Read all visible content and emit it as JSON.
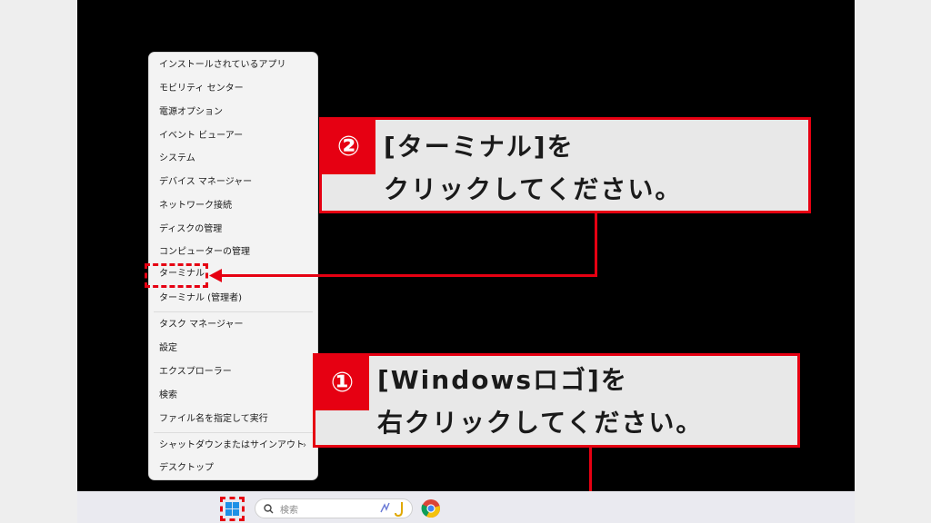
{
  "context_menu": {
    "items": [
      {
        "label": "インストールされているアプリ"
      },
      {
        "label": "モビリティ センター"
      },
      {
        "label": "電源オプション"
      },
      {
        "label": "イベント ビューアー"
      },
      {
        "label": "システム"
      },
      {
        "label": "デバイス マネージャー"
      },
      {
        "label": "ネットワーク接続"
      },
      {
        "label": "ディスクの管理"
      },
      {
        "label": "コンピューターの管理"
      },
      {
        "label": "ターミナル"
      },
      {
        "label": "ターミナル (管理者)"
      },
      {
        "label": "タスク マネージャー"
      },
      {
        "label": "設定"
      },
      {
        "label": "エクスプローラー"
      },
      {
        "label": "検索"
      },
      {
        "label": "ファイル名を指定して実行"
      },
      {
        "label": "シャットダウンまたはサインアウト"
      },
      {
        "label": "デスクトップ"
      }
    ],
    "submenu_arrow": "›"
  },
  "callouts": {
    "step2": {
      "number": "②",
      "line1": "[ターミナル]を",
      "line2": "クリックしてください。"
    },
    "step1": {
      "number": "①",
      "line1": "[Windowsロゴ]を",
      "line2": "右クリックしてください。"
    }
  },
  "taskbar": {
    "search_placeholder": "検索"
  },
  "colors": {
    "accent": "#e60012",
    "callout_bg": "#e8e8e8",
    "screen_bg": "#000000"
  }
}
